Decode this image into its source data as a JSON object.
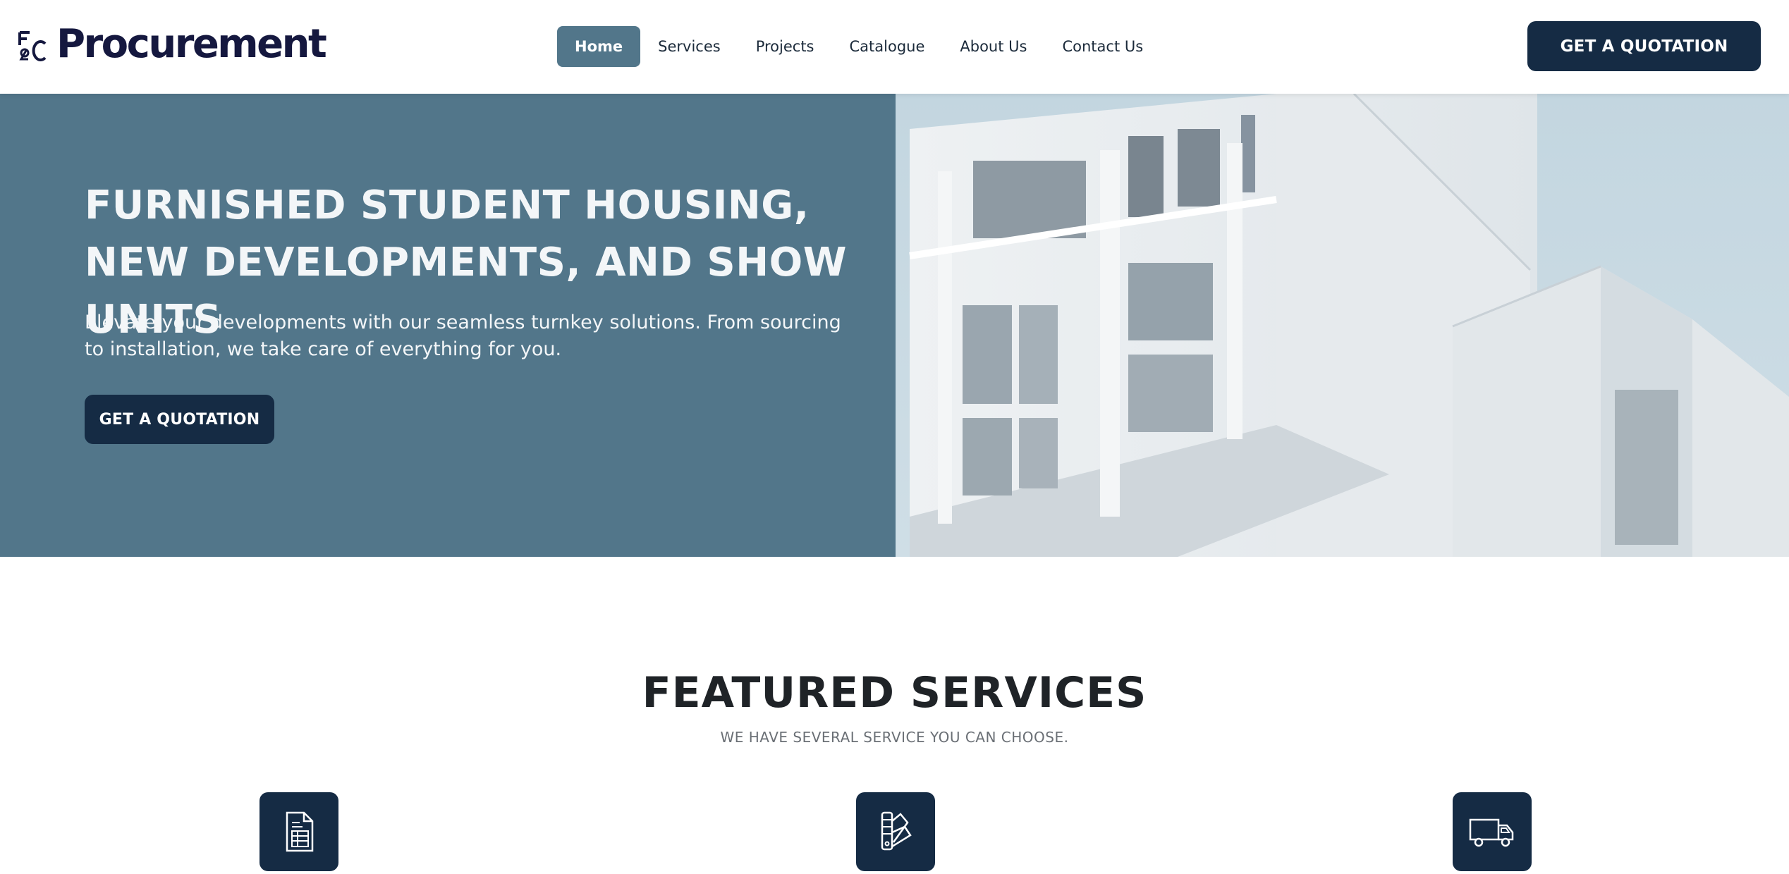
{
  "header": {
    "logo_text": "Procurement",
    "nav": [
      {
        "label": "Home",
        "active": true
      },
      {
        "label": "Services",
        "active": false
      },
      {
        "label": "Projects",
        "active": false
      },
      {
        "label": "Catalogue",
        "active": false
      },
      {
        "label": "About Us",
        "active": false
      },
      {
        "label": "Contact Us",
        "active": false
      }
    ],
    "cta_label": "GET A QUOTATION"
  },
  "hero": {
    "title": "FURNISHED STUDENT HOUSING, NEW DEVELOPMENTS, AND SHOW UNITS",
    "subtitle": "Elevate your developments with our seamless turnkey solutions. From sourcing to installation, we take care of everything for you.",
    "cta_label": "GET A QUOTATION",
    "image_icon": "building-photo"
  },
  "featured": {
    "title": "FEATURED SERVICES",
    "subtitle": "WE HAVE SEVERAL SERVICE YOU CAN CHOOSE.",
    "services": [
      {
        "icon": "document-table-icon"
      },
      {
        "icon": "color-swatch-icon"
      },
      {
        "icon": "delivery-truck-icon"
      }
    ]
  },
  "colors": {
    "brand_navy": "#152b44",
    "hero_blue": "#52768a",
    "logo_navy": "#15183f"
  }
}
